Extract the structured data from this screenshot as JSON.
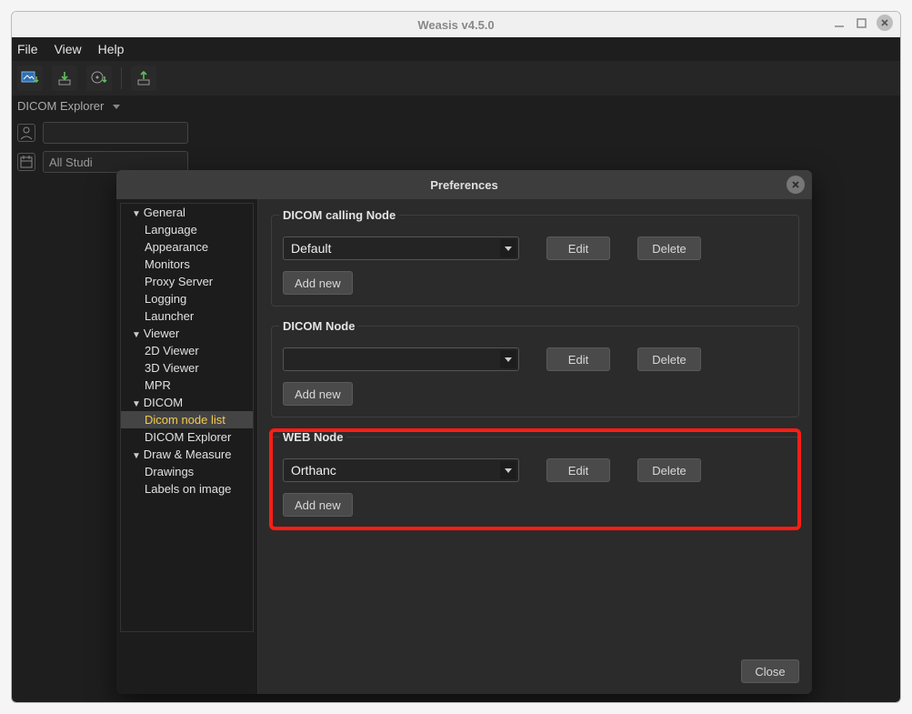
{
  "window": {
    "title": "Weasis v4.5.0"
  },
  "menubar": {
    "file": "File",
    "view": "View",
    "help": "Help"
  },
  "explorer": {
    "title": "DICOM Explorer",
    "all_studies": "All Studi"
  },
  "dialog": {
    "title": "Preferences",
    "close_btn": "Close",
    "tree": {
      "general": "General",
      "language": "Language",
      "appearance": "Appearance",
      "monitors": "Monitors",
      "proxy": "Proxy Server",
      "logging": "Logging",
      "launcher": "Launcher",
      "viewer": "Viewer",
      "v2d": "2D Viewer",
      "v3d": "3D Viewer",
      "mpr": "MPR",
      "dicom": "DICOM",
      "dicom_node_list": "Dicom node list",
      "dicom_explorer": "DICOM Explorer",
      "draw": "Draw & Measure",
      "drawings": "Drawings",
      "labels": "Labels on image"
    },
    "sections": {
      "calling": {
        "title": "DICOM calling Node",
        "selected": "Default",
        "edit": "Edit",
        "delete": "Delete",
        "add": "Add new"
      },
      "node": {
        "title": "DICOM Node",
        "selected": "",
        "edit": "Edit",
        "delete": "Delete",
        "add": "Add new"
      },
      "web": {
        "title": "WEB Node",
        "selected": "Orthanc",
        "edit": "Edit",
        "delete": "Delete",
        "add": "Add new"
      }
    }
  }
}
